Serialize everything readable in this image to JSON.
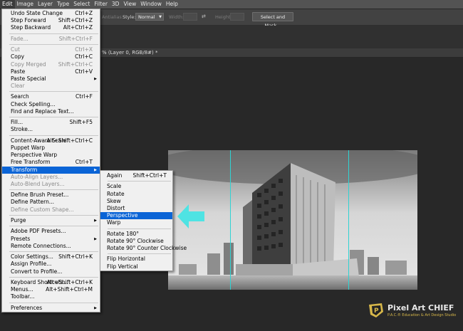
{
  "menubar": {
    "items": [
      "Edit",
      "Image",
      "Layer",
      "Type",
      "Select",
      "Filter",
      "3D",
      "View",
      "Window",
      "Help"
    ]
  },
  "options_bar": {
    "style_label": "Style:",
    "style_value": "Normal",
    "width_label": "Width:",
    "height_label": "Height:",
    "select_mask_button": "Select and Mask...",
    "hidden_left_label": "Antialias"
  },
  "document_tab": {
    "title": "% (Layer 0, RGB/8#) *"
  },
  "edit_menu": [
    {
      "type": "item",
      "label": "Undo State Change",
      "shortcut": "Ctrl+Z",
      "enabled": true
    },
    {
      "type": "item",
      "label": "Step Forward",
      "shortcut": "Shift+Ctrl+Z",
      "enabled": true
    },
    {
      "type": "item",
      "label": "Step Backward",
      "shortcut": "Alt+Ctrl+Z",
      "enabled": true
    },
    {
      "type": "sep"
    },
    {
      "type": "item",
      "label": "Fade...",
      "shortcut": "Shift+Ctrl+F",
      "enabled": false
    },
    {
      "type": "sep"
    },
    {
      "type": "item",
      "label": "Cut",
      "shortcut": "Ctrl+X",
      "enabled": false
    },
    {
      "type": "item",
      "label": "Copy",
      "shortcut": "Ctrl+C",
      "enabled": true
    },
    {
      "type": "item",
      "label": "Copy Merged",
      "shortcut": "Shift+Ctrl+C",
      "enabled": false
    },
    {
      "type": "item",
      "label": "Paste",
      "shortcut": "Ctrl+V",
      "enabled": true
    },
    {
      "type": "item",
      "label": "Paste Special",
      "shortcut": "",
      "enabled": true,
      "submenu": true
    },
    {
      "type": "item",
      "label": "Clear",
      "shortcut": "",
      "enabled": false
    },
    {
      "type": "sep"
    },
    {
      "type": "item",
      "label": "Search",
      "shortcut": "Ctrl+F",
      "enabled": true
    },
    {
      "type": "item",
      "label": "Check Spelling...",
      "shortcut": "",
      "enabled": true
    },
    {
      "type": "item",
      "label": "Find and Replace Text...",
      "shortcut": "",
      "enabled": true
    },
    {
      "type": "sep"
    },
    {
      "type": "item",
      "label": "Fill...",
      "shortcut": "Shift+F5",
      "enabled": true
    },
    {
      "type": "item",
      "label": "Stroke...",
      "shortcut": "",
      "enabled": true
    },
    {
      "type": "sep"
    },
    {
      "type": "item",
      "label": "Content-Aware Scale",
      "shortcut": "Alt+Shift+Ctrl+C",
      "enabled": true
    },
    {
      "type": "item",
      "label": "Puppet Warp",
      "shortcut": "",
      "enabled": true
    },
    {
      "type": "item",
      "label": "Perspective Warp",
      "shortcut": "",
      "enabled": true
    },
    {
      "type": "item",
      "label": "Free Transform",
      "shortcut": "Ctrl+T",
      "enabled": true
    },
    {
      "type": "item",
      "label": "Transform",
      "shortcut": "",
      "enabled": true,
      "submenu": true,
      "highlighted": true
    },
    {
      "type": "item",
      "label": "Auto-Align Layers...",
      "shortcut": "",
      "enabled": false
    },
    {
      "type": "item",
      "label": "Auto-Blend Layers...",
      "shortcut": "",
      "enabled": false
    },
    {
      "type": "sep"
    },
    {
      "type": "item",
      "label": "Define Brush Preset...",
      "shortcut": "",
      "enabled": true
    },
    {
      "type": "item",
      "label": "Define Pattern...",
      "shortcut": "",
      "enabled": true
    },
    {
      "type": "item",
      "label": "Define Custom Shape...",
      "shortcut": "",
      "enabled": false
    },
    {
      "type": "sep"
    },
    {
      "type": "item",
      "label": "Purge",
      "shortcut": "",
      "enabled": true,
      "submenu": true
    },
    {
      "type": "sep"
    },
    {
      "type": "item",
      "label": "Adobe PDF Presets...",
      "shortcut": "",
      "enabled": true
    },
    {
      "type": "item",
      "label": "Presets",
      "shortcut": "",
      "enabled": true,
      "submenu": true
    },
    {
      "type": "item",
      "label": "Remote Connections...",
      "shortcut": "",
      "enabled": true
    },
    {
      "type": "sep"
    },
    {
      "type": "item",
      "label": "Color Settings...",
      "shortcut": "Shift+Ctrl+K",
      "enabled": true
    },
    {
      "type": "item",
      "label": "Assign Profile...",
      "shortcut": "",
      "enabled": true
    },
    {
      "type": "item",
      "label": "Convert to Profile...",
      "shortcut": "",
      "enabled": true
    },
    {
      "type": "sep"
    },
    {
      "type": "item",
      "label": "Keyboard Shortcuts...",
      "shortcut": "Alt+Shift+Ctrl+K",
      "enabled": true
    },
    {
      "type": "item",
      "label": "Menus...",
      "shortcut": "Alt+Shift+Ctrl+M",
      "enabled": true
    },
    {
      "type": "item",
      "label": "Toolbar...",
      "shortcut": "",
      "enabled": true
    },
    {
      "type": "sep"
    },
    {
      "type": "item",
      "label": "Preferences",
      "shortcut": "",
      "enabled": true,
      "submenu": true
    }
  ],
  "transform_menu": [
    {
      "type": "item",
      "label": "Again",
      "shortcut": "Shift+Ctrl+T",
      "enabled": true
    },
    {
      "type": "sep"
    },
    {
      "type": "item",
      "label": "Scale",
      "shortcut": "",
      "enabled": true
    },
    {
      "type": "item",
      "label": "Rotate",
      "shortcut": "",
      "enabled": true
    },
    {
      "type": "item",
      "label": "Skew",
      "shortcut": "",
      "enabled": true
    },
    {
      "type": "item",
      "label": "Distort",
      "shortcut": "",
      "enabled": true
    },
    {
      "type": "item",
      "label": "Perspective",
      "shortcut": "",
      "enabled": true,
      "highlighted": true
    },
    {
      "type": "item",
      "label": "Warp",
      "shortcut": "",
      "enabled": true
    },
    {
      "type": "sep"
    },
    {
      "type": "item",
      "label": "Rotate 180°",
      "shortcut": "",
      "enabled": true
    },
    {
      "type": "item",
      "label": "Rotate 90° Clockwise",
      "shortcut": "",
      "enabled": true
    },
    {
      "type": "item",
      "label": "Rotate 90° Counter Clockwise",
      "shortcut": "",
      "enabled": true
    },
    {
      "type": "sep"
    },
    {
      "type": "item",
      "label": "Flip Horizontal",
      "shortcut": "",
      "enabled": true
    },
    {
      "type": "item",
      "label": "Flip Vertical",
      "shortcut": "",
      "enabled": true
    }
  ],
  "logo": {
    "name": "Pixel Art CHIEF",
    "tagline": "P.A.C.® Education & Art Design Studio",
    "mark_letter": "P"
  },
  "colors": {
    "menu_highlight": "#0a64d6",
    "guide": "#2fd3d3",
    "arrow": "#4fe3e3",
    "logo_accent": "#d8b84a"
  },
  "icons": {
    "submenu": "chevron-right-icon",
    "arrow": "left-arrow-icon",
    "building": "building-image",
    "swap": "swap-arrows-icon"
  }
}
